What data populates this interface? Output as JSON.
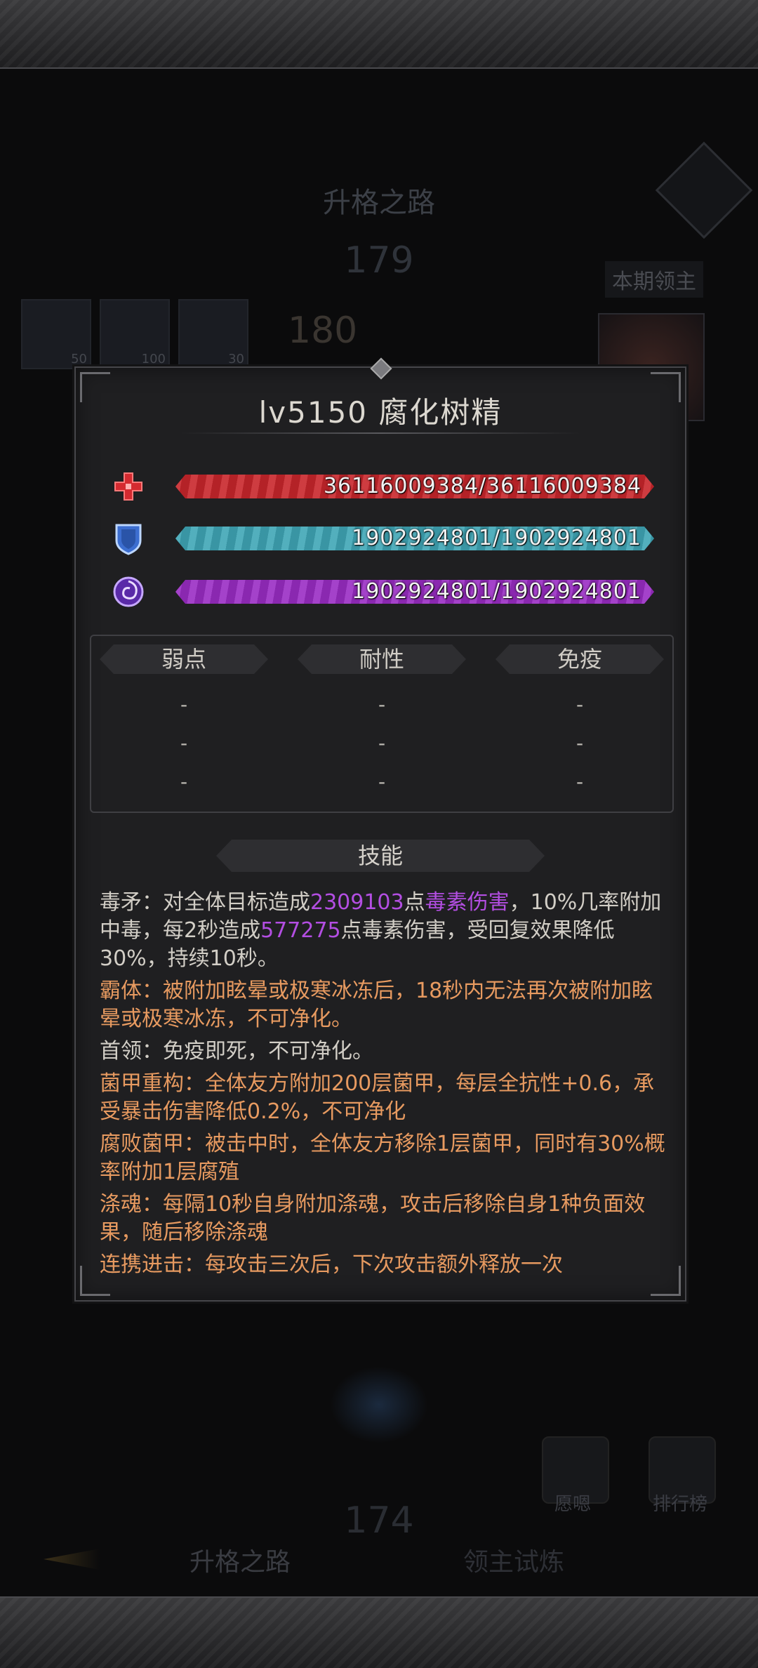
{
  "background": {
    "title": "升格之路",
    "level_top": "179",
    "level_mid": "180",
    "level_bottom": "174",
    "boss_label": "本期领主",
    "slots": [
      "50",
      "100",
      "30"
    ],
    "btn_left_label": "愿嗯",
    "btn_right_label": "排行榜",
    "nav_left": "升格之路",
    "nav_right": "领主试炼"
  },
  "panel": {
    "title": "lv5150  腐化树精",
    "stats": {
      "hp": {
        "value": "36116009384/36116009384",
        "fill": 1.0,
        "color": "#c8262b"
      },
      "shield": {
        "value": "1902924801/1902924801",
        "fill": 1.0,
        "color": "#3fa6b6"
      },
      "energy": {
        "value": "1902924801/1902924801",
        "fill": 1.0,
        "color": "#9a2cc4"
      }
    },
    "resist": {
      "headers": [
        "弱点",
        "耐性",
        "免疫"
      ],
      "weak": [
        "-",
        "-",
        "-"
      ],
      "resistant": [
        "-",
        "-",
        "-"
      ],
      "immune": [
        "-",
        "-",
        "-"
      ]
    },
    "skills_header": "技能",
    "skills": {
      "s1_a": "毒矛：对全体目标造成",
      "s1_b": "2309103",
      "s1_c": "点",
      "s1_d": "毒素伤害",
      "s1_e": "，10%几率附加中毒，每2秒造成",
      "s1_f": "577275",
      "s1_g": "点毒素伤害，受回复效果降低30%，持续10秒。",
      "s2": "霸体：被附加眩晕或极寒冰冻后，18秒内无法再次被附加眩晕或极寒冰冻，不可净化。",
      "s3": "首领：免疫即死，不可净化。",
      "s4": "菌甲重构：全体友方附加200层菌甲，每层全抗性+0.6，承受暴击伤害降低0.2%，不可净化",
      "s5": "腐败菌甲：被击中时，全体友方移除1层菌甲，同时有30%概率附加1层腐殖",
      "s6": "涤魂：每隔10秒自身附加涤魂，攻击后移除自身1种负面效果，随后移除涤魂",
      "s7": "连携进击：每攻击三次后，下次攻击额外释放一次"
    },
    "colors": {
      "accent_purple": "#b34ee2",
      "skill_orange": "#e79a60"
    }
  }
}
